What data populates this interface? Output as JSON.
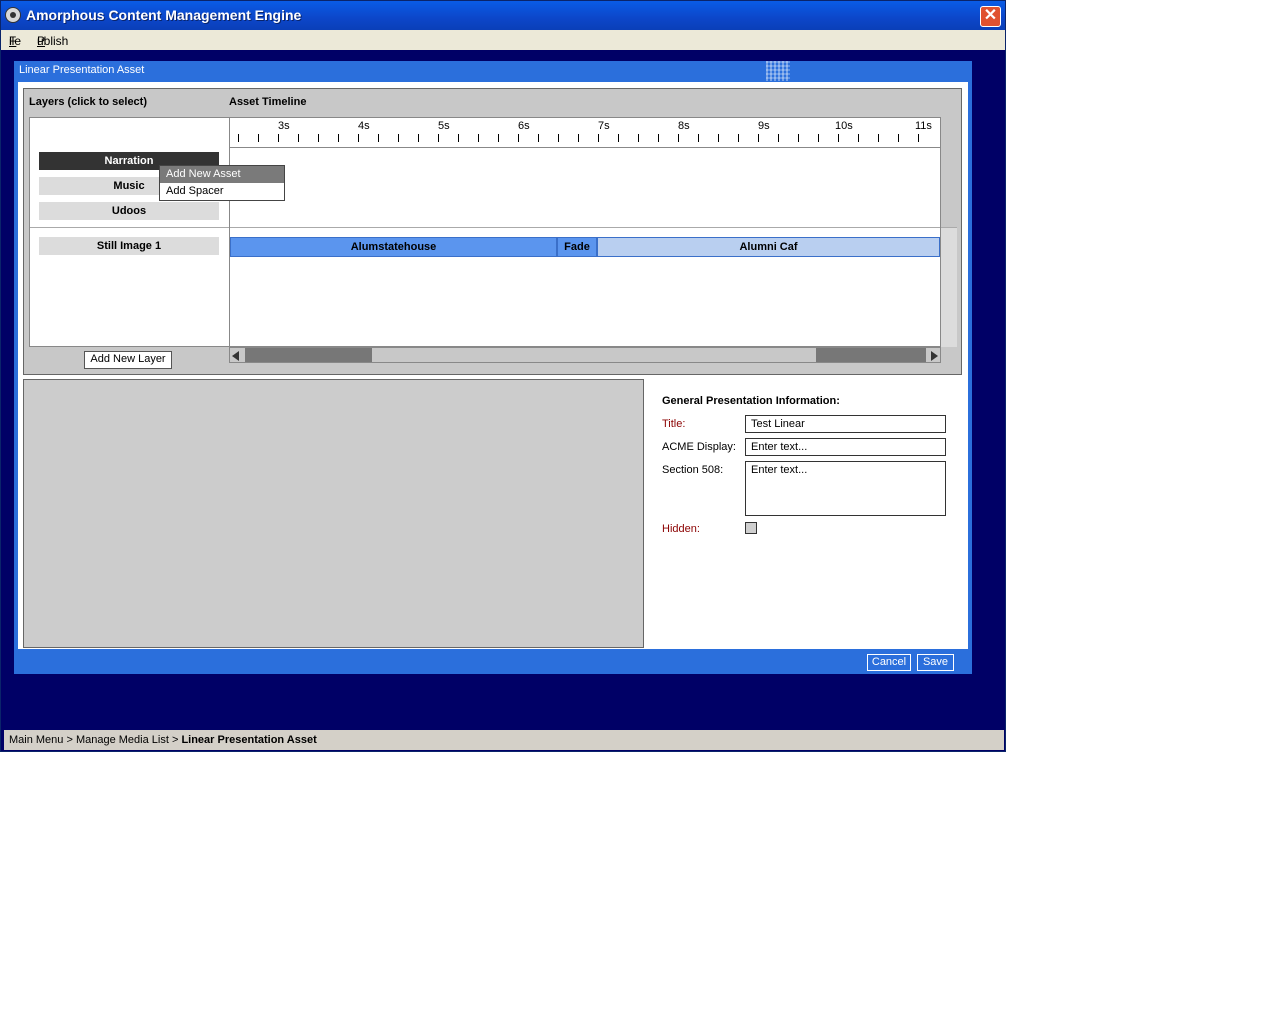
{
  "window": {
    "title": "Amorphous Content Management Engine",
    "close_symbol": "✕"
  },
  "menu": {
    "file_first": "F",
    "file_rest": "ile",
    "publish_first": "P",
    "publish_rest": "ublish"
  },
  "dialog": {
    "title": "Linear Presentation Asset",
    "layers_header": "Layers   (click to select)",
    "timeline_header": "Asset Timeline",
    "layers": [
      {
        "label": "Narration",
        "selected": true
      },
      {
        "label": "Music"
      },
      {
        "label": "Udoos"
      },
      {
        "label": "Still Image 1"
      }
    ],
    "ruler_labels": [
      "3s",
      "4s",
      "5s",
      "6s",
      "7s",
      "8s",
      "9s",
      "10s",
      "11s"
    ],
    "still_track_segments": [
      {
        "label": "Alumstatehouse"
      },
      {
        "label": "Fade"
      },
      {
        "label": "Alumni Caf"
      }
    ],
    "add_layer_label": "Add New Layer",
    "context_menu": {
      "add_asset": "Add New Asset",
      "add_spacer": "Add Spacer"
    },
    "info": {
      "heading": "General Presentation Information:",
      "title_label": "Title:",
      "title_value": "Test Linear",
      "acme_label": "ACME Display:",
      "acme_value": "Enter text...",
      "section_label": "Section 508:",
      "section_value": "Enter text...",
      "hidden_label": "Hidden:",
      "hidden_checked": false
    },
    "cancel_label": "Cancel",
    "save_label": "Save"
  },
  "breadcrumb": {
    "parts": "Main Menu > Manage Media List > ",
    "current": "Linear Presentation Asset"
  },
  "colors": {
    "window_bg": "#000066",
    "dialog_blue": "#2b6fdc",
    "segment_blue": "#5b95ee",
    "segment_light": "#b9cff0",
    "selected_layer": "#333333",
    "required_label": "#8b0000"
  }
}
